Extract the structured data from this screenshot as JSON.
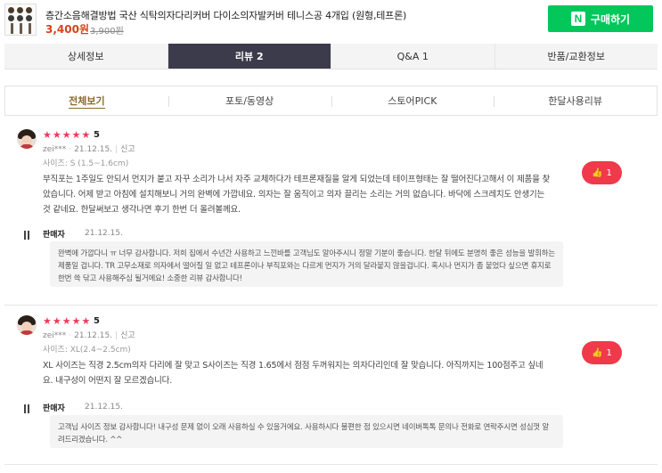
{
  "product": {
    "title": "층간소음해결방법 국산 식탁의자다리커버 다이소의자발커버 테니스공 4개입 (원형,테프론)",
    "price": "3,400원",
    "original_price": "3,900원",
    "buy_label": "구매하기",
    "buy_logo": "N",
    "buy_color": "#03c75a"
  },
  "main_tabs": [
    {
      "label": "상세정보",
      "active": false
    },
    {
      "label": "리뷰 2",
      "active": true
    },
    {
      "label": "Q&A 1",
      "active": false
    },
    {
      "label": "반품/교환정보",
      "active": false
    }
  ],
  "sub_tabs": [
    {
      "label": "전체보기",
      "active": true
    },
    {
      "label": "포토/동영상",
      "active": false
    },
    {
      "label": "스토어PICK",
      "active": false
    },
    {
      "label": "한달사용리뷰",
      "active": false
    }
  ],
  "reviews": [
    {
      "rating": 5,
      "score_text": "5",
      "user": "zei***",
      "date": "21.12.15.",
      "report_label": "신고",
      "option": "사이즈: S (1.5~1.6cm)",
      "text": "부직포는 1주일도 안되서 먼지가 붙고 자꾸 소리가 나서 자주 교체하다가 테프론재질을 알게 되었는데 테이프형태는 잘 떨어진다고해서 이 제품을 찾았습니다. 어제 받고 아침에 설치해보니 거의 완벽에 가깝네요. 의자는 잘 움직이고 의자 끌리는 소리는 거의 없습니다. 바닥에 스크레치도 안생기는 것 같네요. 한달써보고 생각나면 후기 한번 더 올려볼께요.",
      "likes": "1",
      "seller_label": "판매자",
      "seller_date": "21.12.15.",
      "seller_reply": "완벽에 가깝다니 ㅠ 너무 감사합니다. 저희 집에서 수년간 사용하고 느낀바를 고객님도 알아주시니 정말 기분이 좋습니다. 한달 뒤에도 분명히 좋은 성능을 발휘하는 제품일 겁니다. TR 고무소재로 의자에서 떨어질 일 없고 테프론이나 부직포와는 다르게 먼지가 거의 달라붙지 않을겁니다. 혹시나 먼지가 좀 붙었다 싶으면 휴지로 한번 쓱 닦고 사용해주심 될거에요! 소중한 리뷰 감사합니다!"
    },
    {
      "rating": 5,
      "score_text": "5",
      "user": "zei***",
      "date": "21.12.15.",
      "report_label": "신고",
      "option": "사이즈: XL(2.4~2.5cm)",
      "text": "XL 사이즈는 직경 2.5cm의자 다리에 잘 맞고 S사이즈는 직경 1.65에서 점점 두꺼워지는 의자다리인데 잘 맞습니다. 아직까지는 100점주고 싶네요. 내구성이 어떤지 잘 모르겠습니다.",
      "likes": "1",
      "seller_label": "판매자",
      "seller_date": "21.12.15.",
      "seller_reply": "고객님 사이즈 정보 감사합니다! 내구성 문제 없이 오래 사용하실 수 있을거에요. 사용하시다 불편한 점 있으시면 네이버톡톡 문의나 전화로 연락주시면 성심껏 알려드리겠습니다. ^^"
    }
  ],
  "colors": {
    "accent_tab": "#3b3b4c",
    "star": "#f0395a",
    "like": "#f0394a",
    "price": "#d4431a"
  },
  "icons": [
    "star-icon",
    "thumbs-up-icon",
    "naver-logo-icon",
    "avatar"
  ]
}
